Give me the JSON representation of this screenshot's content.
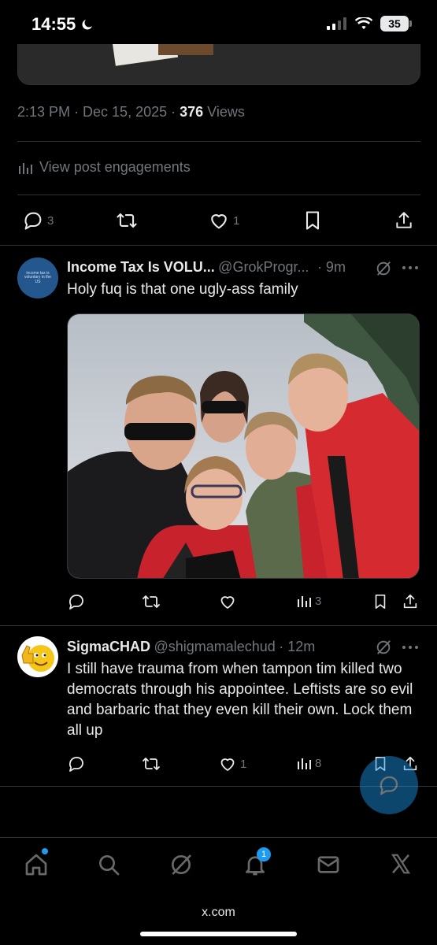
{
  "status_bar": {
    "time": "14:55",
    "battery": "35"
  },
  "post": {
    "timestamp": "2:13 PM · Dec 15, 2025 · ",
    "views_count": "376",
    "views_label": " Views",
    "engagements_label": "View post engagements",
    "actions": {
      "replies": "3",
      "likes": "1"
    }
  },
  "replies": [
    {
      "display_name": "Income Tax Is VOLU...",
      "handle": "@GrokProgr...",
      "time": "· 9m",
      "avatar_text": "income tax is voluntary in the US",
      "text": "Holy fuq is that one ugly-ass family",
      "actions": {
        "views": "3"
      }
    },
    {
      "display_name": "SigmaCHAD",
      "handle": "@shigmamalechud",
      "time": "· 12m",
      "text": "I still have trauma from when tampon tim killed two democrats through his appointee. Leftists are so evil and barbaric that they even kill their own. Lock them all up",
      "actions": {
        "likes": "1",
        "views": "8"
      }
    }
  ],
  "bottom_nav": {
    "notifications_badge": "1",
    "url": "x.com"
  },
  "colors": {
    "background": "#000000",
    "accent": "#1d9bf0",
    "muted": "#71767b",
    "text": "#e7e9ea"
  }
}
